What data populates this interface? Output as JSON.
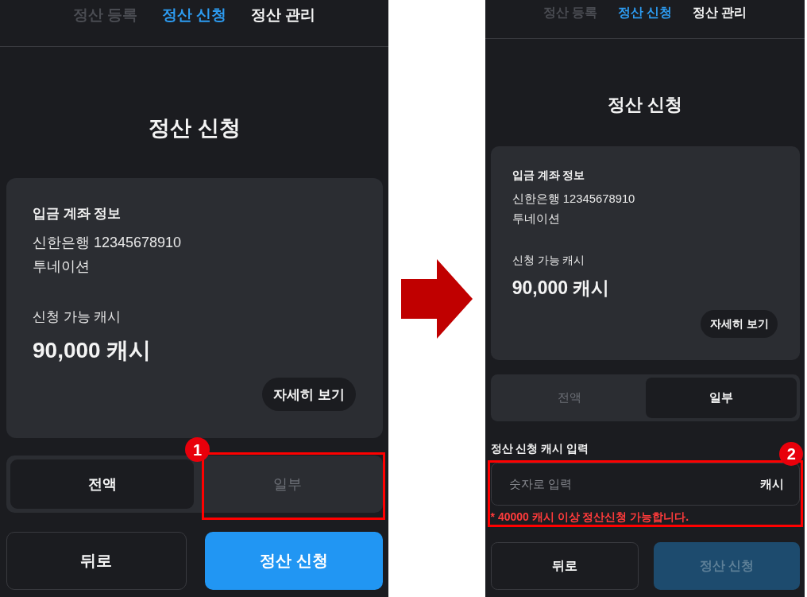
{
  "screens": [
    {
      "tabs": [
        {
          "label": "정산 등록",
          "selected": false,
          "disabled": true
        },
        {
          "label": "정산 신청",
          "selected": true,
          "disabled": false
        },
        {
          "label": "정산 관리",
          "selected": false,
          "disabled": false
        }
      ],
      "title": "정산 신청",
      "account_card": {
        "heading": "입금 계좌 정보",
        "bank_account": "신한은행 12345678910",
        "holder": "투네이션",
        "balance_label": "신청 가능 캐시",
        "balance": "90,000 캐시",
        "details_button": "자세히 보기"
      },
      "amount_options": [
        {
          "label": "전액",
          "selected": true
        },
        {
          "label": "일부",
          "selected": false,
          "annotation": {
            "number": "1"
          }
        }
      ],
      "actions": [
        {
          "label": "뒤로",
          "kind": "secondary",
          "disabled": false
        },
        {
          "label": "정산 신청",
          "kind": "primary",
          "disabled": false
        }
      ]
    },
    {
      "tabs": [
        {
          "label": "정산 등록",
          "selected": false,
          "disabled": true
        },
        {
          "label": "정산 신청",
          "selected": true,
          "disabled": false
        },
        {
          "label": "정산 관리",
          "selected": false,
          "disabled": false
        }
      ],
      "title": "정산 신청",
      "account_card": {
        "heading": "입금 계좌 정보",
        "bank_account": "신한은행 12345678910",
        "holder": "투네이션",
        "balance_label": "신청 가능 캐시",
        "balance": "90,000 캐시",
        "details_button": "자세히 보기"
      },
      "amount_options": [
        {
          "label": "전액",
          "selected": false
        },
        {
          "label": "일부",
          "selected": true
        }
      ],
      "cash_input": {
        "label": "정산 신청 캐시 입력",
        "placeholder": "숫자로 입력",
        "unit": "캐시",
        "error": "* 40000 캐시 이상 정산신청 가능합니다.",
        "annotation": {
          "number": "2"
        }
      },
      "actions": [
        {
          "label": "뒤로",
          "kind": "secondary",
          "disabled": false
        },
        {
          "label": "정산 신청",
          "kind": "primary",
          "disabled": true
        }
      ]
    }
  ]
}
